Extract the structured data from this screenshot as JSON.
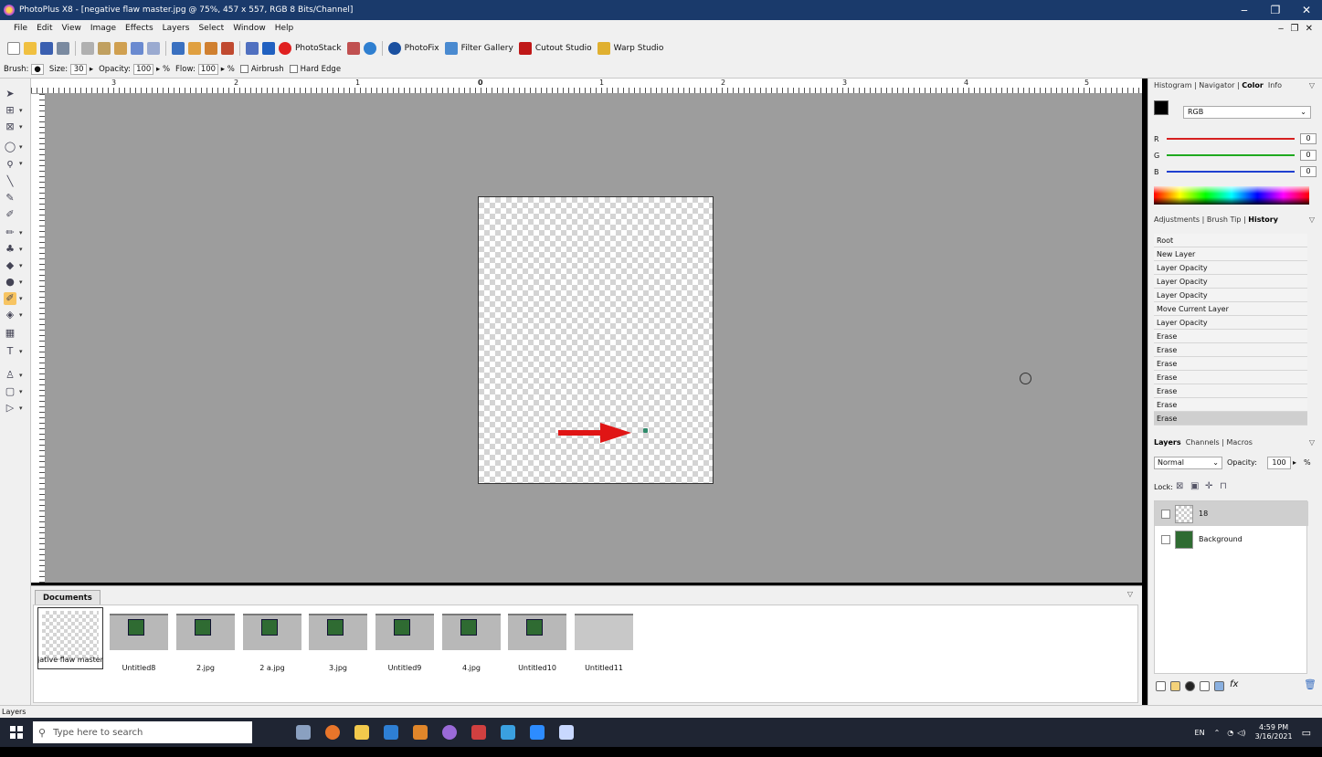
{
  "window": {
    "title": "PhotoPlus X8 - [negative flaw master.jpg @ 75%, 457 x 557, RGB 8 Bits/Channel]",
    "controls": [
      "‒",
      "❐",
      "✕"
    ],
    "mdi_controls": "‒ ❐ ✕"
  },
  "menu": [
    "File",
    "Edit",
    "View",
    "Image",
    "Effects",
    "Layers",
    "Select",
    "Window",
    "Help"
  ],
  "toolbar": {
    "photostack": "PhotoStack",
    "photofix": "PhotoFix",
    "filter_gallery": "Filter Gallery",
    "cutout_studio": "Cutout Studio",
    "warp_studio": "Warp Studio"
  },
  "context": {
    "brush_label": "Brush:",
    "size_label": "Size:",
    "size_value": "30",
    "opacity_label": "Opacity:",
    "opacity_value": "100",
    "percent": "%",
    "flow_label": "Flow:",
    "flow_value": "100",
    "airbrush_label": "Airbrush",
    "hard_edge_label": "Hard Edge"
  },
  "ruler": {
    "labels": [
      "3",
      "2",
      "1",
      "0",
      "1",
      "2",
      "3",
      "4",
      "5"
    ]
  },
  "documents": {
    "title": "Documents",
    "items": [
      "jative flaw master",
      "Untitled8",
      "2.jpg",
      "2 a.jpg",
      "3.jpg",
      "Untitled9",
      "4.jpg",
      "Untitled10",
      "Untitled11"
    ]
  },
  "color_panel": {
    "tabs": {
      "histogram": "Histogram",
      "navigator": "Navigator",
      "color": "Color",
      "info": "Info"
    },
    "mode": "RGB",
    "r_label": "R",
    "g_label": "G",
    "b_label": "B",
    "r_value": "0",
    "g_value": "0",
    "b_value": "0",
    "colors": {
      "r": "#d62020",
      "g": "#1fa91f",
      "b": "#1f3fd0"
    }
  },
  "history_panel": {
    "tabs": {
      "adjustments": "Adjustments",
      "brush_tip": "Brush Tip",
      "history": "History"
    },
    "items": [
      "Root",
      "New Layer",
      "Layer Opacity",
      "Layer Opacity",
      "Layer Opacity",
      "Move Current Layer",
      "Layer Opacity",
      "Erase",
      "Erase",
      "Erase",
      "Erase",
      "Erase",
      "Erase",
      "Erase"
    ]
  },
  "layers_panel": {
    "tabs": {
      "layers": "Layers",
      "channels": "Channels",
      "macros": "Macros"
    },
    "blend_mode": "Normal",
    "opacity_label": "Opacity:",
    "opacity_value": "100",
    "percent": "%",
    "lock_label": "Lock:",
    "layers": [
      "18",
      "Background"
    ]
  },
  "statusbar": {
    "text": "Layers"
  },
  "taskbar": {
    "search_placeholder": "Type here to search",
    "language": "EN",
    "time": "4:59 PM",
    "date": "3/16/2021"
  },
  "accent_colors": {
    "titlebar": "#1a3a6b",
    "active_tool": "#f7c462",
    "annotation_arrow": "#e01515"
  }
}
